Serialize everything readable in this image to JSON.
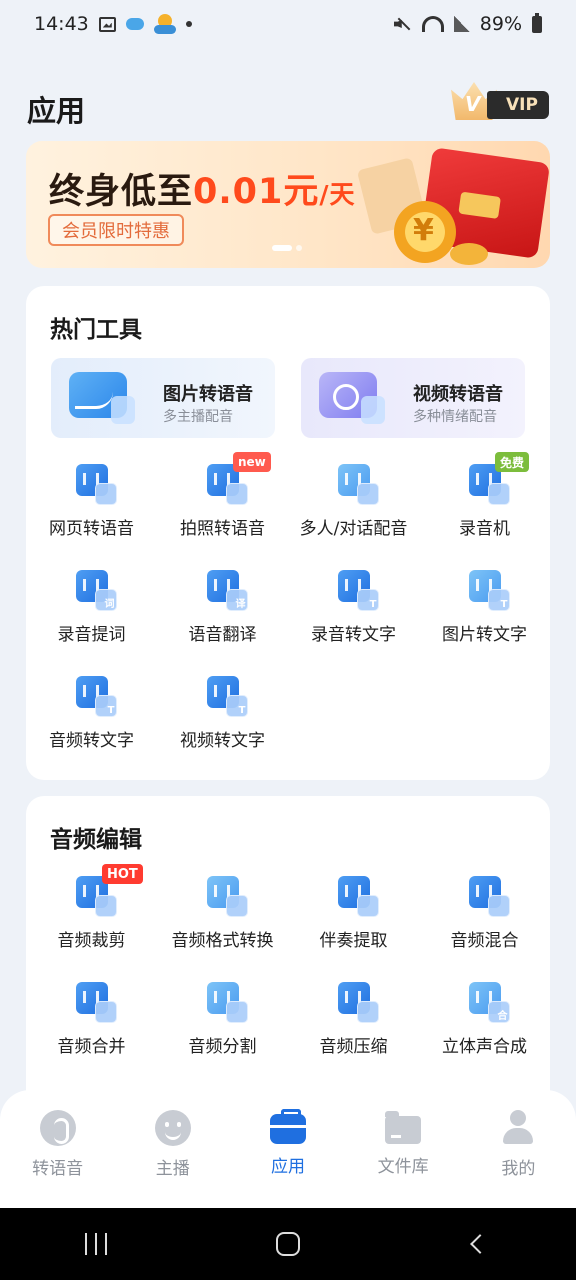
{
  "status_bar": {
    "time": "14:43",
    "battery": "89%"
  },
  "header": {
    "title": "应用",
    "vip_crown_letter": "V",
    "vip_label": "VIP"
  },
  "banner": {
    "headline_prefix": "终身低至",
    "price": "0.01元",
    "unit": "/天",
    "tag": "会员限时特惠",
    "slides": 2,
    "active_slide": 1
  },
  "hot_tools": {
    "title": "热门工具",
    "features": [
      {
        "name": "图片转语音",
        "sub": "多主播配音",
        "icon": "image-voice-icon"
      },
      {
        "name": "视频转语音",
        "sub": "多种情绪配音",
        "icon": "video-voice-icon"
      }
    ],
    "tools": [
      {
        "label": "网页转语音",
        "icon": "webpage-voice-icon",
        "glyph": "</>",
        "badge": ""
      },
      {
        "label": "拍照转语音",
        "icon": "photo-voice-icon",
        "glyph": "",
        "badge": "new"
      },
      {
        "label": "多人/对话配音",
        "icon": "dialogue-dub-icon",
        "glyph": "",
        "badge": ""
      },
      {
        "label": "录音机",
        "icon": "recorder-icon",
        "glyph": "",
        "badge": "免费"
      },
      {
        "label": "录音提词",
        "icon": "teleprompter-icon",
        "glyph": "词",
        "badge": ""
      },
      {
        "label": "语音翻译",
        "icon": "voice-translate-icon",
        "glyph": "译",
        "badge": ""
      },
      {
        "label": "录音转文字",
        "icon": "record-to-text-icon",
        "glyph": "T",
        "badge": ""
      },
      {
        "label": "图片转文字",
        "icon": "image-to-text-icon",
        "glyph": "T",
        "badge": ""
      },
      {
        "label": "音频转文字",
        "icon": "audio-to-text-icon",
        "glyph": "T",
        "badge": ""
      },
      {
        "label": "视频转文字",
        "icon": "video-to-text-icon",
        "glyph": "T",
        "badge": ""
      }
    ]
  },
  "audio_edit": {
    "title": "音频编辑",
    "tools": [
      {
        "label": "音频裁剪",
        "icon": "audio-crop-icon",
        "glyph": "",
        "badge": "HOT"
      },
      {
        "label": "音频格式转换",
        "icon": "audio-format-icon",
        "glyph": "</>",
        "badge": ""
      },
      {
        "label": "伴奏提取",
        "icon": "accompaniment-icon",
        "glyph": "↑",
        "badge": ""
      },
      {
        "label": "音频混合",
        "icon": "audio-mix-icon",
        "glyph": "",
        "badge": ""
      },
      {
        "label": "音频合并",
        "icon": "audio-merge-icon",
        "glyph": "",
        "badge": ""
      },
      {
        "label": "音频分割",
        "icon": "audio-split-icon",
        "glyph": "",
        "badge": ""
      },
      {
        "label": "音频压缩",
        "icon": "audio-compress-icon",
        "glyph": "",
        "badge": ""
      },
      {
        "label": "立体声合成",
        "icon": "stereo-icon",
        "glyph": "合",
        "badge": ""
      }
    ]
  },
  "tabbar": {
    "tabs": [
      {
        "label": "转语音",
        "icon": "voice-tab-icon"
      },
      {
        "label": "主播",
        "icon": "anchor-tab-icon"
      },
      {
        "label": "应用",
        "icon": "app-tab-icon"
      },
      {
        "label": "文件库",
        "icon": "folder-tab-icon"
      },
      {
        "label": "我的",
        "icon": "user-tab-icon"
      }
    ],
    "active": 2,
    "active_color": "#1f6fe0"
  },
  "colors": {
    "accent": "#1f6fe0",
    "price": "#ff4a1c",
    "hot_badge": "#ff3b30",
    "free_badge": "#7cbd3c"
  }
}
